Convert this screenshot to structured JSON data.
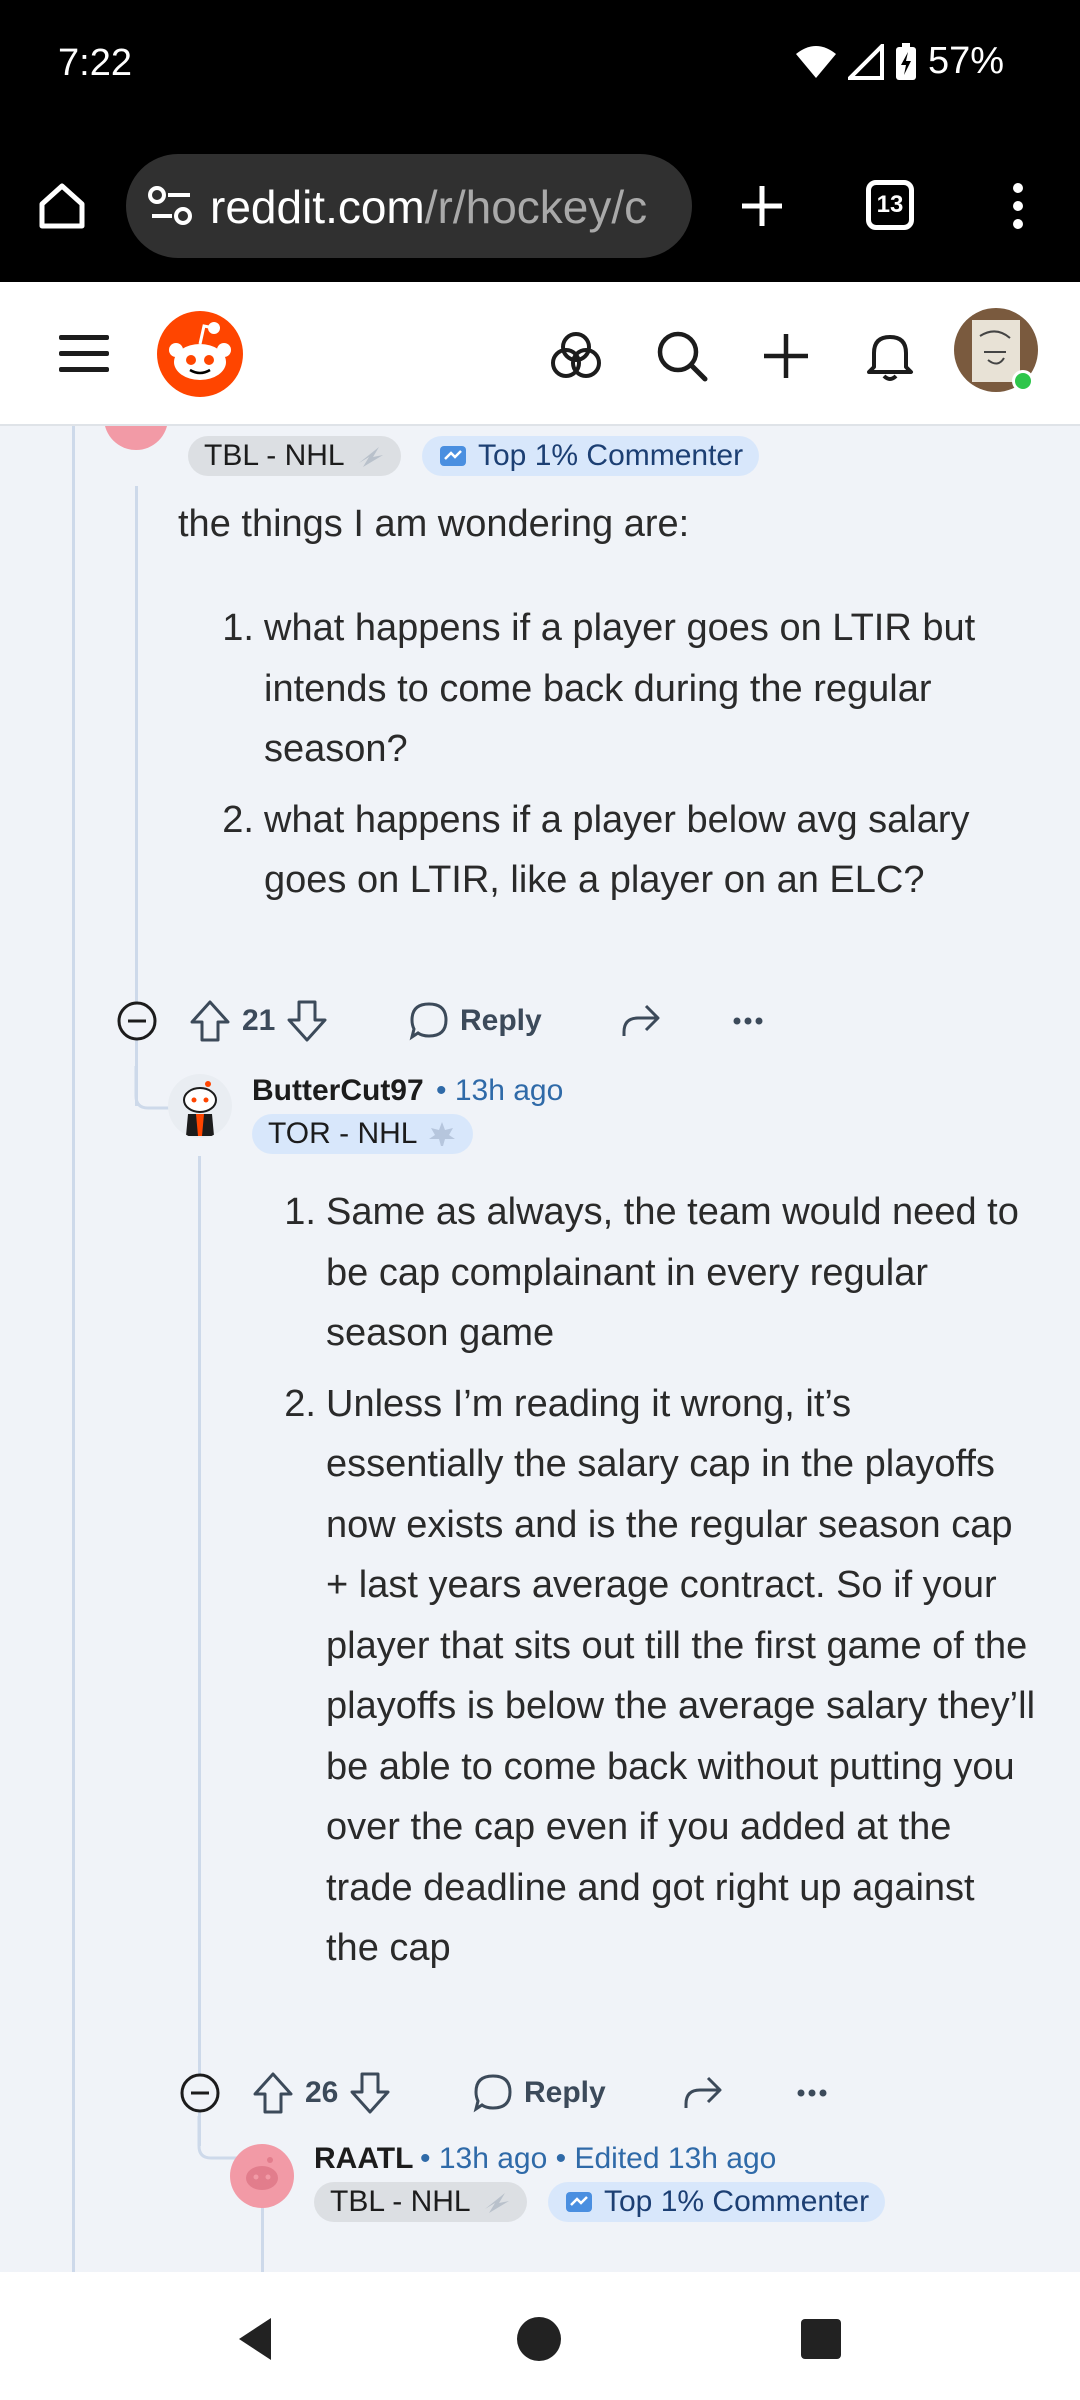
{
  "status": {
    "time": "7:22",
    "battery": "57%"
  },
  "browser": {
    "url_host": "reddit.com",
    "url_path": "/r/hockey/c",
    "tab_count": "13"
  },
  "comments": {
    "c1": {
      "flair_team": "TBL - NHL",
      "flair_badge": "Top 1% Commenter",
      "intro": "the things I am wondering are:",
      "items": [
        "what happens if a player goes on LTIR but intends to come back during the regular season?",
        "what happens if a player below avg salary goes on LTIR, like a player on an ELC?"
      ],
      "votes": "21",
      "reply_label": "Reply"
    },
    "c2": {
      "username": "ButterCut97",
      "time": "13h ago",
      "flair_team": "TOR - NHL",
      "items": [
        "Same as always, the team would need to be cap complainant in every regular season game",
        "Unless I’m reading it wrong, it’s essentially the salary cap in the playoffs now exists and is the regular season cap + last years average contract. So if your player that sits out till the first game of the playoffs is below the average salary they’ll be able to come back without putting you over the cap even if you added at the trade deadline and got right up against the cap"
      ],
      "votes": "26",
      "reply_label": "Reply"
    },
    "c3": {
      "username": "RAATL",
      "time": "13h ago",
      "edited": "Edited 13h ago",
      "flair_team": "TBL - NHL",
      "flair_badge": "Top 1% Commenter"
    }
  },
  "colors": {
    "reddit_orange": "#ff4500",
    "meta_blue": "#2f6aa8",
    "thread_line": "#cdd9ea"
  },
  "icons": [
    "home-icon",
    "site-settings-icon",
    "new-tab-icon",
    "tabs-icon",
    "overflow-menu-icon",
    "hamburger-menu-icon",
    "reddit-logo",
    "communities-icon",
    "search-icon",
    "create-post-icon",
    "notifications-icon",
    "avatar",
    "collapse-icon",
    "upvote-icon",
    "downvote-icon",
    "reply-icon",
    "share-icon",
    "more-icon",
    "back-icon",
    "home-nav-icon",
    "recents-icon"
  ]
}
